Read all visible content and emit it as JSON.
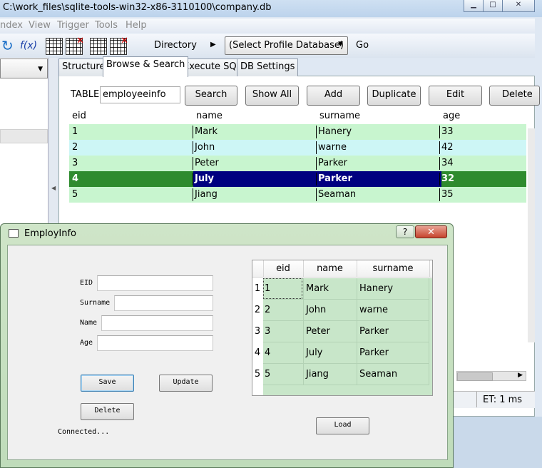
{
  "main_window": {
    "title": "C:\\work_files\\sqlite-tools-win32-x86-3110100\\company.db",
    "menu": [
      "ndex",
      "View",
      "Trigger",
      "Tools",
      "Help"
    ],
    "toolbar": {
      "fx_label": "f(x)",
      "directory_label": "Directory",
      "profile_select_value": "(Select Profile Database)",
      "go_label": "Go"
    },
    "tabs": [
      "Structure",
      "Browse & Search",
      "Execute SQL",
      "DB Settings"
    ],
    "active_tab": "Browse & Search",
    "browse": {
      "table_label": "TABLE",
      "table_value": "employeeinfo",
      "buttons": [
        "Search",
        "Show All",
        "Add",
        "Duplicate",
        "Edit",
        "Delete"
      ]
    },
    "grid": {
      "columns": [
        "eid",
        "name",
        "surname",
        "age"
      ],
      "rows": [
        [
          "1",
          "Mark",
          "Hanery",
          "33"
        ],
        [
          "2",
          "John",
          "warne",
          "42"
        ],
        [
          "3",
          "Peter",
          "Parker",
          "34"
        ],
        [
          "4",
          "July",
          "Parker",
          "32"
        ],
        [
          "5",
          "Jiang",
          "Seaman",
          "35"
        ]
      ],
      "selected_row": 3
    },
    "status": {
      "elapsed": "ET: 1 ms"
    },
    "colors": {
      "row_even": "#c8f5cf",
      "row_odd": "#cdf6f6",
      "selected_left": "#000080",
      "selected_right": "#2e8b2e"
    }
  },
  "dialog": {
    "title": "EmployInfo",
    "help_label": "?",
    "close_label": "✕",
    "fields": {
      "eid_label": "EID",
      "surname_label": "Surname",
      "name_label": "Name",
      "age_label": "Age"
    },
    "buttons": {
      "save": "Save",
      "update": "Update",
      "delete": "Delete",
      "load": "Load"
    },
    "status_text": "Connected...",
    "table": {
      "columns": [
        "eid",
        "name",
        "surname"
      ],
      "row_numbers": [
        "1",
        "2",
        "3",
        "4",
        "5"
      ],
      "rows": [
        [
          "1",
          "Mark",
          "Hanery"
        ],
        [
          "2",
          "John",
          "warne"
        ],
        [
          "3",
          "Peter",
          "Parker"
        ],
        [
          "4",
          "July",
          "Parker"
        ],
        [
          "5",
          "Jiang",
          "Seaman"
        ]
      ]
    }
  }
}
